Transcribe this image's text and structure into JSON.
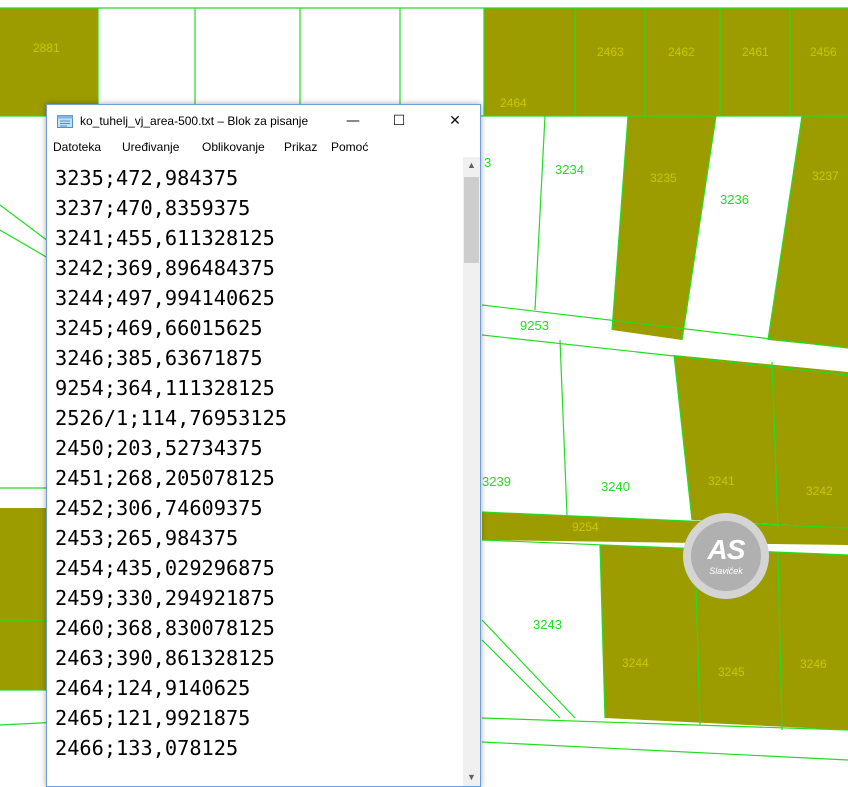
{
  "window": {
    "title": "ko_tuhelj_vj_area-500.txt – Blok za pisanje",
    "minimize_glyph": "—",
    "maximize_glyph": "☐",
    "close_glyph": "✕",
    "icon": "notepad-icon"
  },
  "menu": [
    "Datoteka",
    "Uređivanje",
    "Oblikovanje",
    "Prikaz",
    "Pomoć"
  ],
  "lines": [
    "3235;472,984375",
    "3237;470,8359375",
    "3241;455,611328125",
    "3242;369,896484375",
    "3244;497,994140625",
    "3245;469,66015625",
    "3246;385,63671875",
    "9254;364,111328125",
    "2526/1;114,76953125",
    "2450;203,52734375",
    "2451;268,205078125",
    "2452;306,74609375",
    "2453;265,984375",
    "2454;435,029296875",
    "2459;330,294921875",
    "2460;368,830078125",
    "2463;390,861328125",
    "2464;124,9140625",
    "2465;121,9921875",
    "2466;133,078125"
  ],
  "scrollbar": {
    "up_glyph": "▲",
    "down_glyph": "▼"
  },
  "map": {
    "parcel_fill": "#9c9c00",
    "line_color": "#22dd22",
    "labels": {
      "p3": "3",
      "p3234": "3234",
      "p3236": "3236",
      "p9253": "9253",
      "p3239": "3239",
      "p3240": "3240",
      "p3243": "3243"
    }
  },
  "watermark": {
    "big": "AS",
    "small": "Slaviček"
  }
}
